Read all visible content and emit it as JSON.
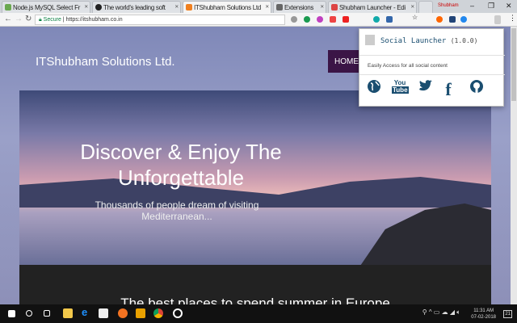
{
  "tabs": [
    {
      "label": "Node.js MySQL Select Fr",
      "color": "#6aa84f"
    },
    {
      "label": "The world's leading soft",
      "color": "#222222"
    },
    {
      "label": "ITShubham Solutions Ltd",
      "color": "#f08020"
    },
    {
      "label": "Extensions",
      "color": "#666666"
    },
    {
      "label": "Shubham Launcher - Edi",
      "color": "#dd4444"
    }
  ],
  "window": {
    "user": "Shubham",
    "minimize": "–",
    "restore": "❐",
    "close": "✕"
  },
  "addressbar": {
    "secure": "Secure",
    "url": "https://itshubham.co.in"
  },
  "site": {
    "brand": "ITShubham Solutions Ltd.",
    "nav_home": "HOME",
    "hero_title": "Discover & Enjoy The Unforgettable",
    "hero_sub": "Thousands of people dream of visiting Mediterranean...",
    "section_title": "The best places to spend summer in Europe"
  },
  "popup": {
    "title": "Social Launcher",
    "version": "(1.0.0)",
    "description": "Easily Access for all social content",
    "icons": [
      "globe-icon",
      "youtube-icon",
      "twitter-icon",
      "facebook-icon",
      "github-icon"
    ]
  },
  "taskbar": {
    "time": "11:31 AM",
    "date": "07-02-2018",
    "notifications": "21"
  }
}
